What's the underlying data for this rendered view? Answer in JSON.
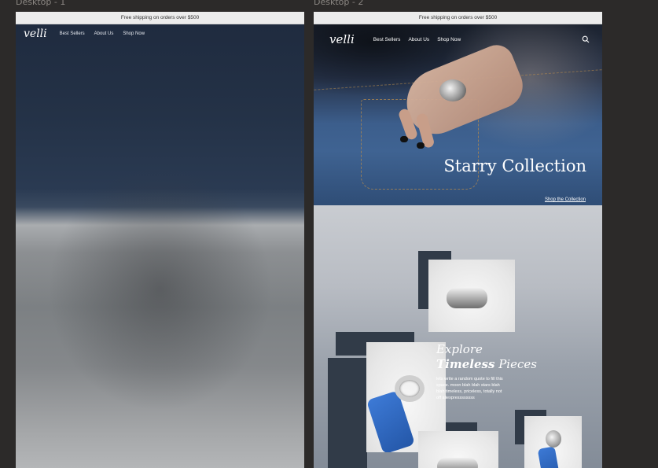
{
  "frames": [
    {
      "label": "Desktop - 1",
      "promo": "Free shipping on orders over $500",
      "nav": {
        "logo": "velli",
        "links": [
          "Best Sellers",
          "About Us",
          "Shop Now"
        ]
      }
    },
    {
      "label": "Desktop - 2",
      "promo": "Free shipping on orders over $500",
      "nav": {
        "logo": "velli",
        "links": [
          "Best Sellers",
          "About Us",
          "Shop Now"
        ],
        "search_icon": "search-icon"
      },
      "hero": {
        "title": "Starry Collection",
        "link": "Shop the Collection"
      },
      "section": {
        "heading_line1": "Explore",
        "heading_bold": "Timeless",
        "heading_end": "Pieces",
        "body": "lets write a random quote to fill this space. moon blah blah stars blah blah timeless, priceless, totally not off aliexpressssssss"
      }
    }
  ],
  "colors": {
    "canvas": "#2c2a29",
    "navy": "#1f2b3f",
    "block": "#313b48",
    "denim": "#3f6392",
    "accent_blue": "#2457a8"
  }
}
